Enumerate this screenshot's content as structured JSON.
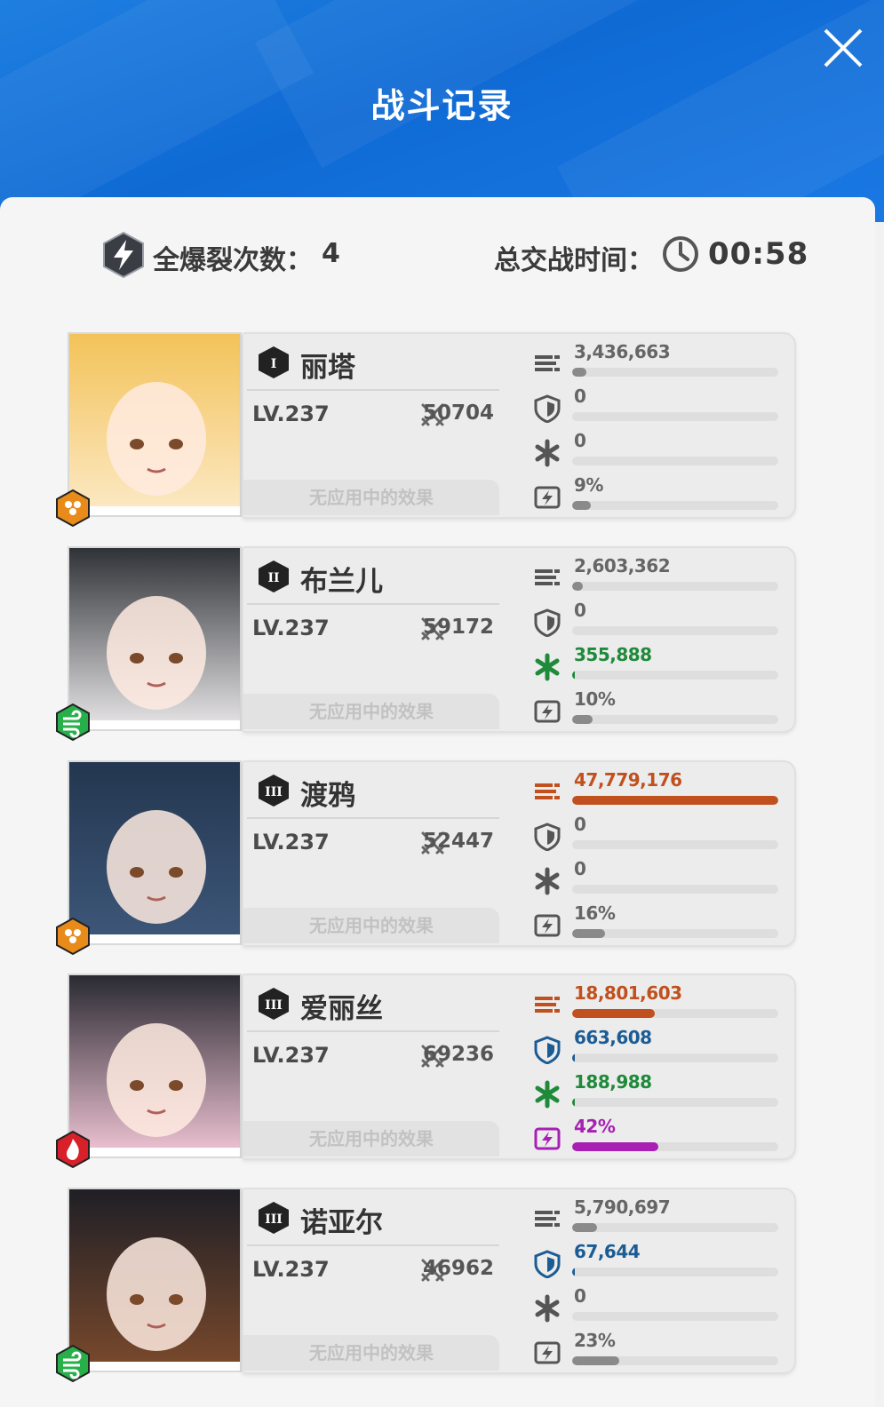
{
  "title": "战斗记录",
  "summary": {
    "burst_label": "全爆裂次数：",
    "burst_count": "4",
    "time_label": "总交战时间：",
    "time_value": "00:58"
  },
  "colors": {
    "header_blue": "#1877e0",
    "damage_highlight": "#c0501e",
    "shield_highlight": "#1b5c94",
    "heal_highlight": "#1f8a3a",
    "burst_highlight": "#a81fb4",
    "neutral_bar": "#8a8a8a"
  },
  "characters": [
    {
      "rank": "I",
      "name": "丽塔",
      "level": "LV.237",
      "power": "50704",
      "effects": "无应用中的效果",
      "element": "iron",
      "element_icon": "hex-honeycomb-icon",
      "damage": {
        "text": "3,436,663",
        "fill": 0.07
      },
      "shield": {
        "text": "0",
        "fill": 0
      },
      "heal": {
        "text": "0",
        "fill": 0
      },
      "burst": {
        "text": "9%",
        "fill": 0.09
      }
    },
    {
      "rank": "II",
      "name": "布兰儿",
      "level": "LV.237",
      "power": "59172",
      "effects": "无应用中的效果",
      "element": "wind",
      "element_icon": "wind-icon",
      "damage": {
        "text": "2,603,362",
        "fill": 0.05
      },
      "shield": {
        "text": "0",
        "fill": 0
      },
      "heal": {
        "text": "355,888",
        "fill": 0.01
      },
      "burst": {
        "text": "10%",
        "fill": 0.1
      }
    },
    {
      "rank": "III",
      "name": "渡鸦",
      "level": "LV.237",
      "power": "52447",
      "effects": "无应用中的效果",
      "element": "iron",
      "element_icon": "hex-honeycomb-icon",
      "damage": {
        "text": "47,779,176",
        "fill": 1.0
      },
      "shield": {
        "text": "0",
        "fill": 0
      },
      "heal": {
        "text": "0",
        "fill": 0
      },
      "burst": {
        "text": "16%",
        "fill": 0.16
      }
    },
    {
      "rank": "III",
      "name": "爱丽丝",
      "level": "LV.237",
      "power": "69236",
      "effects": "无应用中的效果",
      "element": "fire",
      "element_icon": "fire-icon",
      "damage": {
        "text": "18,801,603",
        "fill": 0.4
      },
      "shield": {
        "text": "663,608",
        "fill": 0.015
      },
      "heal": {
        "text": "188,988",
        "fill": 0.005
      },
      "burst": {
        "text": "42%",
        "fill": 0.42
      }
    },
    {
      "rank": "III",
      "name": "诺亚尔",
      "level": "LV.237",
      "power": "46962",
      "effects": "无应用中的效果",
      "element": "wind",
      "element_icon": "wind-icon",
      "damage": {
        "text": "5,790,697",
        "fill": 0.12
      },
      "shield": {
        "text": "67,644",
        "fill": 0.005
      },
      "heal": {
        "text": "0",
        "fill": 0
      },
      "burst": {
        "text": "23%",
        "fill": 0.23
      }
    }
  ]
}
